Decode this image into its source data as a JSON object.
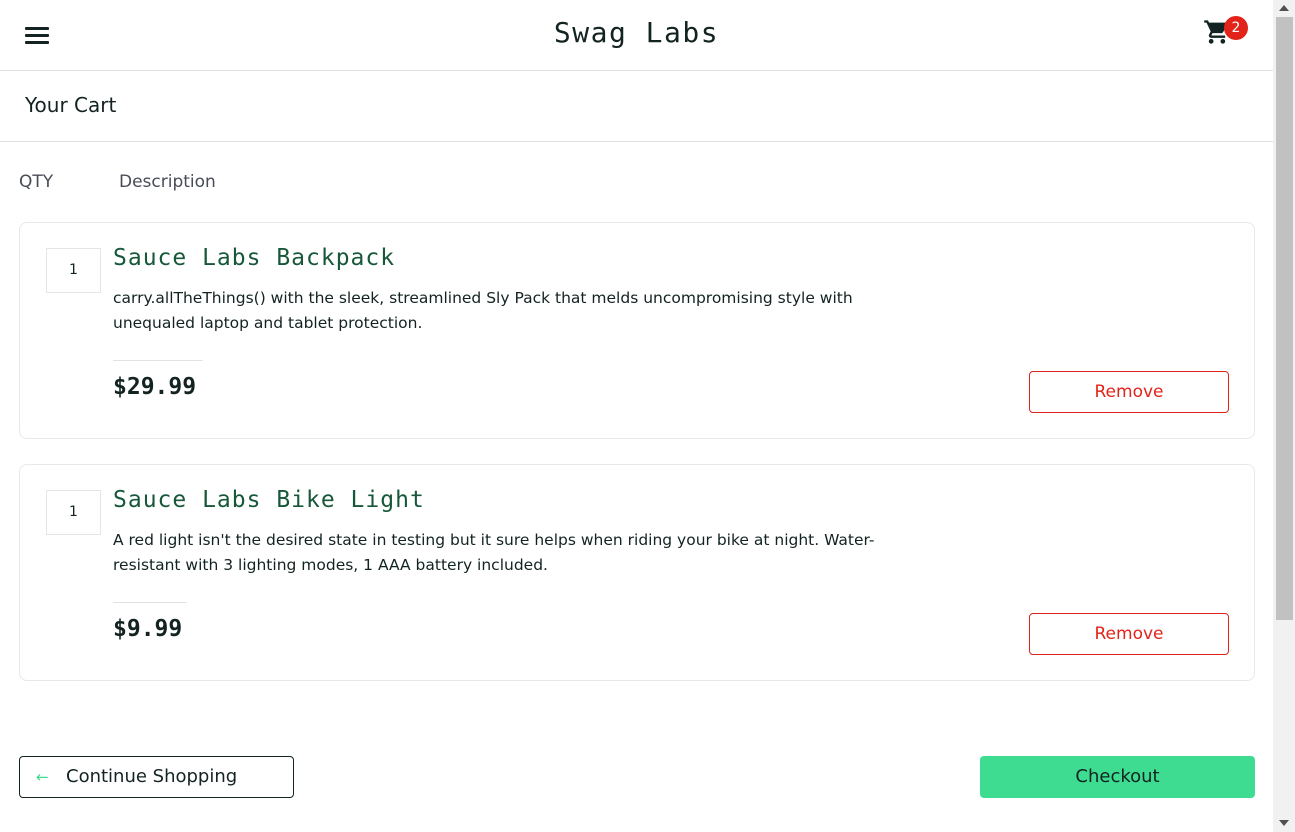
{
  "header": {
    "app_logo": "Swag Labs",
    "menu_icon": "hamburger-menu-icon",
    "cart_icon": "shopping-cart-icon",
    "cart_badge_count": "2"
  },
  "page": {
    "title": "Your Cart",
    "column_qty": "QTY",
    "column_description": "Description"
  },
  "cart": {
    "items": [
      {
        "quantity": "1",
        "name": "Sauce Labs Backpack",
        "description": "carry.allTheThings() with the sleek, streamlined Sly Pack that melds uncompromising style with unequaled laptop and tablet protection.",
        "price": "$29.99",
        "remove_label": "Remove"
      },
      {
        "quantity": "1",
        "name": "Sauce Labs Bike Light",
        "description": "A red light isn't the desired state in testing but it sure helps when riding your bike at night. Water-resistant with 3 lighting modes, 1 AAA battery included.",
        "price": "$9.99",
        "remove_label": "Remove"
      }
    ]
  },
  "footer": {
    "continue_label": "Continue Shopping",
    "continue_icon": "arrow-left-icon",
    "checkout_label": "Checkout"
  },
  "colors": {
    "accent": "#3ddc91",
    "item_name": "#18583a",
    "danger": "#e2231a",
    "text": "#132322"
  }
}
